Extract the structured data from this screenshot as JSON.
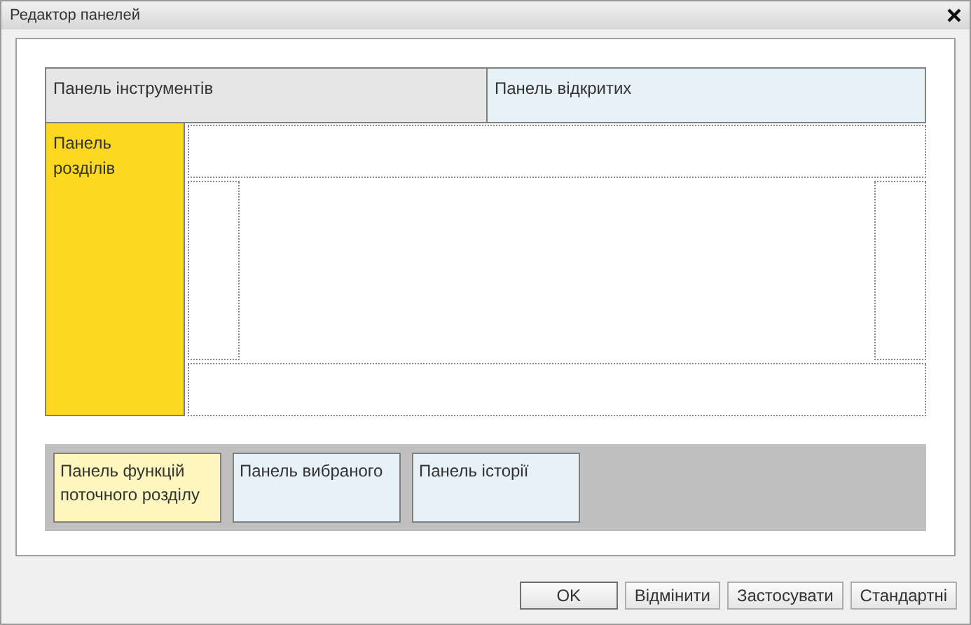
{
  "window": {
    "title": "Редактор панелей"
  },
  "top_panels": [
    {
      "label": "Панель інструментів",
      "color": "#e6e6e6"
    },
    {
      "label": "Панель відкритих",
      "color": "#e6f2f8"
    }
  ],
  "left_panel": {
    "label": "Панель розділів",
    "color": "#fcd920"
  },
  "bottom_panels": [
    {
      "label": "Панель функцій поточного розділу",
      "color": "#fdf6bf"
    },
    {
      "label": "Панель вибраного",
      "color": "#e6f2f8"
    },
    {
      "label": "Панель історії",
      "color": "#e6f2f8"
    }
  ],
  "buttons": [
    "OK",
    "Відмінити",
    "Застосувати",
    "Стандартні"
  ]
}
